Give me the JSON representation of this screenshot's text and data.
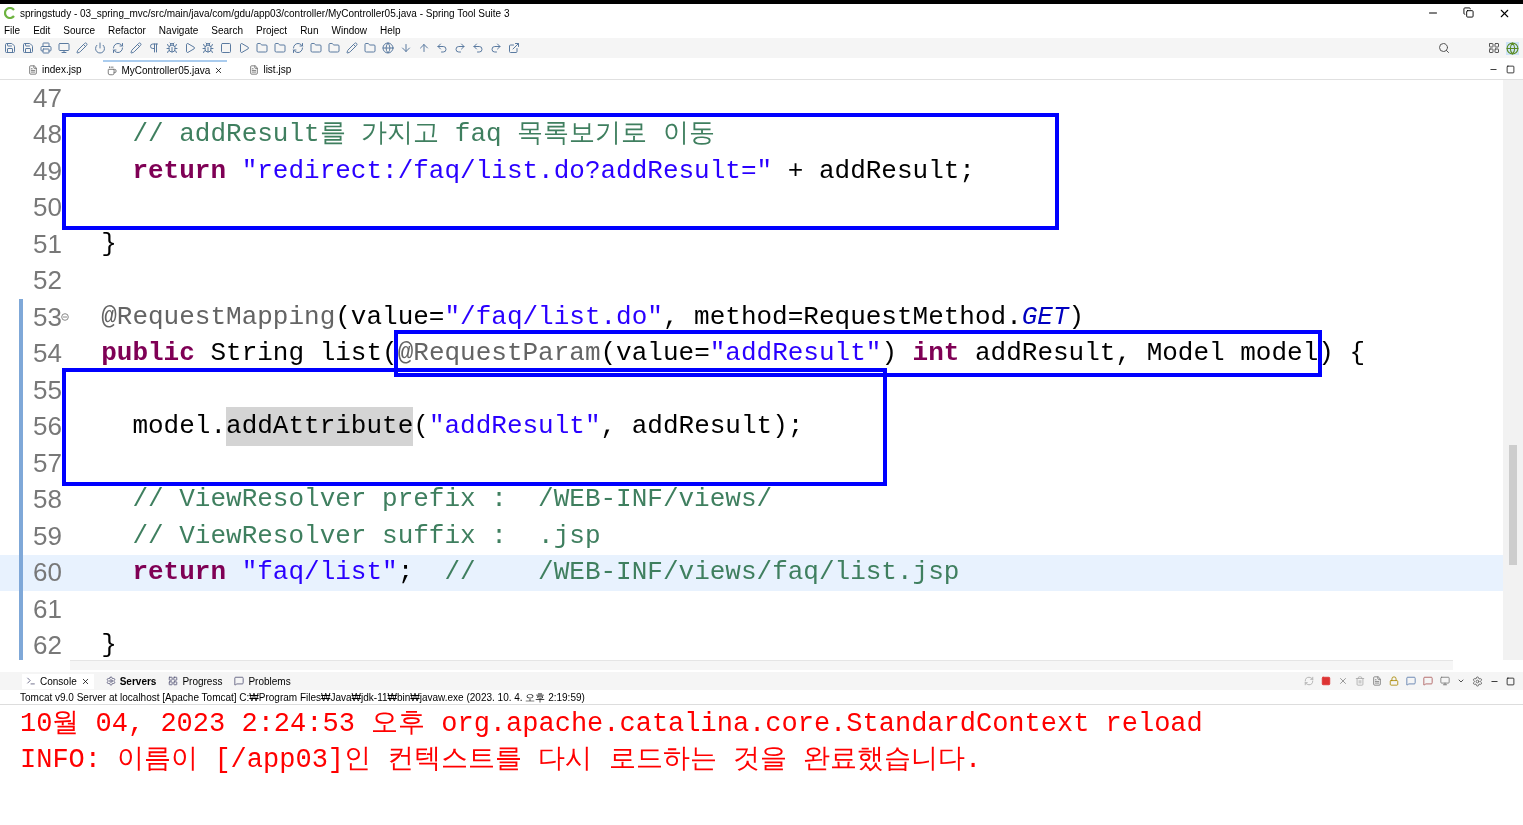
{
  "window": {
    "title": "springstudy - 03_spring_mvc/src/main/java/com/gdu/app03/controller/MyController05.java - Spring Tool Suite 3"
  },
  "menu": [
    "File",
    "Edit",
    "Source",
    "Refactor",
    "Navigate",
    "Search",
    "Project",
    "Run",
    "Window",
    "Help"
  ],
  "editor_tabs": [
    {
      "label": "index.jsp",
      "selected": false,
      "kind": "jsp"
    },
    {
      "label": "MyController05.java",
      "selected": true,
      "kind": "java"
    },
    {
      "label": "list.jsp",
      "selected": false,
      "kind": "jsp"
    }
  ],
  "code": [
    {
      "number": "47"
    },
    {
      "kind": "box",
      "lines": [
        {
          "number": "48",
          "tokens": [
            {
              "kind": "comment",
              "text": "    // addResult를 가지고 faq 목록보기로 이동"
            }
          ]
        },
        {
          "number": "49",
          "tokens": [
            {
              "kind": "keyword",
              "text": "    return "
            },
            {
              "kind": "string",
              "text": "\"redirect:/faq/list.do?addResult=\""
            },
            {
              "kind": "plain",
              "text": " + addResult;"
            }
          ]
        },
        {
          "number": "50"
        }
      ]
    },
    {
      "number": "51",
      "tokens": [
        {
          "kind": "plain",
          "text": "  }"
        }
      ]
    },
    {
      "number": "52"
    },
    {
      "number": "53",
      "foldable": true,
      "changed": true,
      "tokens": [
        {
          "kind": "annotation",
          "text": "  @RequestMapping"
        },
        {
          "kind": "plain",
          "text": "(value="
        },
        {
          "kind": "string",
          "text": "\"/faq/list.do\""
        },
        {
          "kind": "plain",
          "text": ", method=RequestMethod."
        },
        {
          "kind": "constant",
          "text": "GET"
        },
        {
          "kind": "plain",
          "text": ")"
        }
      ]
    },
    {
      "number": "54",
      "changed": true,
      "tokens": [
        {
          "kind": "keyword",
          "text": "  public"
        },
        {
          "kind": "plain",
          "text": " String list("
        },
        {
          "kind": "box",
          "tokens": [
            {
              "kind": "annotation",
              "text": "@RequestParam"
            },
            {
              "kind": "plain",
              "text": "(value="
            },
            {
              "kind": "string",
              "text": "\"addResult\""
            },
            {
              "kind": "plain",
              "text": ") "
            },
            {
              "kind": "keyword",
              "text": "int"
            },
            {
              "kind": "plain",
              "text": " addResult, Model model"
            }
          ]
        },
        {
          "kind": "plain",
          "text": ") {"
        }
      ]
    },
    {
      "kind": "box",
      "lines": [
        {
          "number": "55",
          "changed": true
        },
        {
          "number": "56",
          "changed": true,
          "tokens": [
            {
              "kind": "plain",
              "text": "    model."
            },
            {
              "kind": "plain",
              "text": "addAttribute",
              "highlighted": true
            },
            {
              "kind": "plain",
              "text": "("
            },
            {
              "kind": "string",
              "text": "\"addResult\""
            },
            {
              "kind": "plain",
              "text": ", addResult);"
            }
          ]
        },
        {
          "number": "57",
          "changed": true
        }
      ]
    },
    {
      "number": "58",
      "changed": true,
      "tokens": [
        {
          "kind": "comment",
          "text": "    // ViewResolver prefix :  /WEB-INF/views/"
        }
      ]
    },
    {
      "number": "59",
      "changed": true,
      "tokens": [
        {
          "kind": "comment",
          "text": "    // ViewResolver suffix :  .jsp"
        }
      ]
    },
    {
      "number": "60",
      "changed": true,
      "current": true,
      "tokens": [
        {
          "kind": "keyword",
          "text": "    return "
        },
        {
          "kind": "string",
          "text": "\"faq/list\""
        },
        {
          "kind": "plain",
          "text": ";  "
        },
        {
          "kind": "comment",
          "text": "//    /WEB-INF/views/faq/list.jsp"
        }
      ]
    },
    {
      "number": "61",
      "changed": true
    },
    {
      "number": "62",
      "changed": true,
      "tokens": [
        {
          "kind": "plain",
          "text": "  }"
        }
      ]
    }
  ],
  "console_tabs": [
    {
      "label": "Console",
      "selected": true,
      "kind": "console"
    },
    {
      "label": "Servers",
      "selected": false,
      "kind": "servers"
    },
    {
      "label": "Progress",
      "selected": false,
      "kind": "progress"
    },
    {
      "label": "Problems",
      "selected": false,
      "kind": "problems"
    }
  ],
  "console_description": "Tomcat v9.0 Server at localhost [Apache Tomcat] C:₩Program Files₩Java₩jdk-11₩bin₩javaw.exe  (2023. 10. 4. 오후 2:19:59)",
  "console_output": [
    {
      "kind": "error",
      "text": "10월 04, 2023 2:24:53 오후 org.apache.catalina.core.StandardContext reload"
    },
    {
      "kind": "error",
      "text": "INFO: 이름이 [/app03]인 컨텍스트를 다시 로드하는 것을 완료했습니다."
    }
  ]
}
